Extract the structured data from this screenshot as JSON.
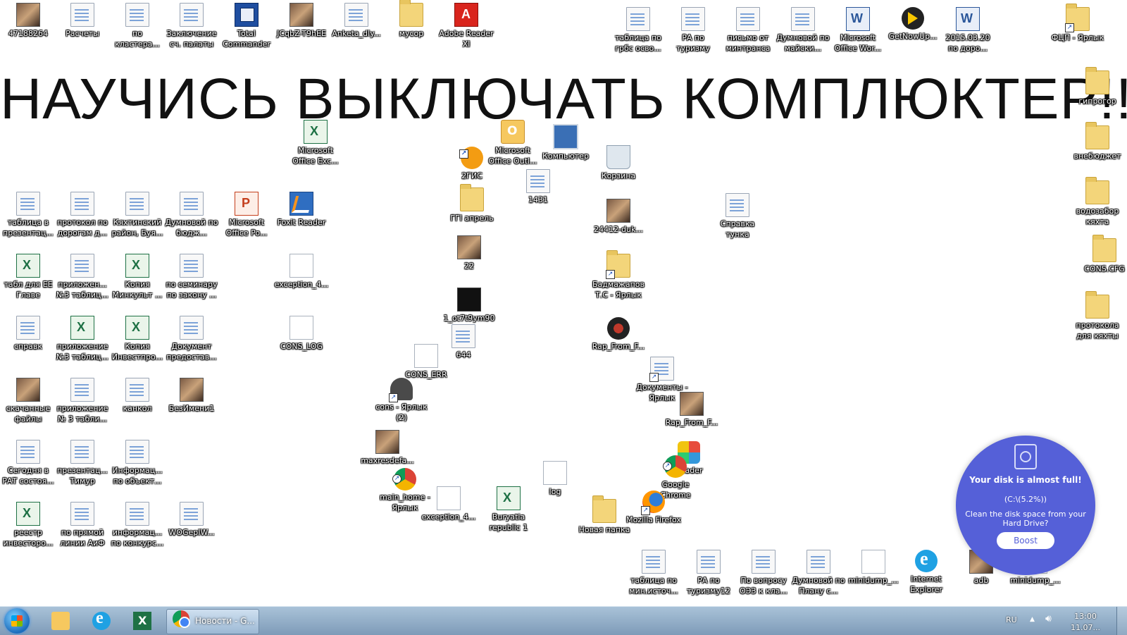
{
  "banner": "НАУЧИСЬ ВЫКЛЮЧАТЬ КОМПЛЮКТЕР!!!!",
  "icons": [
    {
      "label": "47188264",
      "type": "photo"
    },
    {
      "label": "Расчеты",
      "type": "doc"
    },
    {
      "label": "по кластера...",
      "type": "doc"
    },
    {
      "label": "Заключение сч. палаты",
      "type": "doc"
    },
    {
      "label": "Total Commander",
      "type": "tc"
    },
    {
      "label": "JCqbZ-T9hEE",
      "type": "photo"
    },
    {
      "label": "Anketa_dly...",
      "type": "doc"
    },
    {
      "label": "мусор",
      "type": "folder"
    },
    {
      "label": "Adobe Reader XI",
      "type": "pdf"
    },
    {
      "label": "таблица по грбс осво...",
      "type": "doc"
    },
    {
      "label": "РА по туризму",
      "type": "doc"
    },
    {
      "label": "письмо от минтранса",
      "type": "doc"
    },
    {
      "label": "Думновой по майски...",
      "type": "doc"
    },
    {
      "label": "Microsoft Office Wor...",
      "type": "word"
    },
    {
      "label": "GetNowUp...",
      "type": "getnow"
    },
    {
      "label": "2015.03.20 по доро...",
      "type": "word"
    },
    {
      "label": "ФЦП - Ярлык",
      "type": "folder"
    },
    {
      "label": "гипрогор",
      "type": "folder"
    },
    {
      "label": "внебюджет",
      "type": "folder"
    },
    {
      "label": "водозабор кяхта",
      "type": "folder"
    },
    {
      "label": "CONS.CFG",
      "type": "folder"
    },
    {
      "label": "протокола для кяхты",
      "type": "folder"
    },
    {
      "label": "Microsoft Office Exc...",
      "type": "xls"
    },
    {
      "label": "Microsoft Office Outl...",
      "type": "outlook"
    },
    {
      "label": "Компьютер",
      "type": "pc"
    },
    {
      "label": "2ГИС",
      "type": "gis"
    },
    {
      "label": "Корзина",
      "type": "bin"
    },
    {
      "label": "1431",
      "type": "doc"
    },
    {
      "label": "ГГI апрель",
      "type": "folder"
    },
    {
      "label": "22",
      "type": "photo"
    },
    {
      "label": "1_ot7t9ym90",
      "type": "dark"
    },
    {
      "label": "644",
      "type": "doc"
    },
    {
      "label": "CONS_ERR",
      "type": "blank"
    },
    {
      "label": "cons - Ярлык (2)",
      "type": "cons"
    },
    {
      "label": "maxresdefa...",
      "type": "photo"
    },
    {
      "label": "main_home - Ярлык",
      "type": "chrome"
    },
    {
      "label": "exception_4...",
      "type": "blank"
    },
    {
      "label": "Buryatia republic 1",
      "type": "xls"
    },
    {
      "label": "log",
      "type": "blank"
    },
    {
      "label": "24412-duk...",
      "type": "photo"
    },
    {
      "label": "Бадмажапов Т.С - Ярлык",
      "type": "folder"
    },
    {
      "label": "Rap_From_F...",
      "type": "rap"
    },
    {
      "label": "Документы - Ярлык",
      "type": "doc"
    },
    {
      "label": "Rap_From_F...",
      "type": "photo"
    },
    {
      "label": "Reader",
      "type": "reader"
    },
    {
      "label": "Google Chrome",
      "type": "chrome"
    },
    {
      "label": "Новая папка",
      "type": "folder"
    },
    {
      "label": "Mozilla Firefox",
      "type": "firefox"
    },
    {
      "label": "Справка тунка",
      "type": "doc"
    },
    {
      "label": "таблица в презентац...",
      "type": "doc"
    },
    {
      "label": "протокол по дорогам д...",
      "type": "doc"
    },
    {
      "label": "Кяхтинский район, Буя...",
      "type": "doc"
    },
    {
      "label": "Думновой по бюдж...",
      "type": "doc"
    },
    {
      "label": "Microsoft Office Po...",
      "type": "ppt"
    },
    {
      "label": "Foxit Reader",
      "type": "foxit"
    },
    {
      "label": "табл для ЕЕ Главе",
      "type": "xls"
    },
    {
      "label": "приложен... №3 таблиц...",
      "type": "doc"
    },
    {
      "label": "Копия Минкульт ...",
      "type": "xls"
    },
    {
      "label": "по семинару по закону ...",
      "type": "doc"
    },
    {
      "label": "exception_4...",
      "type": "blank"
    },
    {
      "label": "справк",
      "type": "doc"
    },
    {
      "label": "приложение №3 таблиц...",
      "type": "xls"
    },
    {
      "label": "Копия Инвестпро...",
      "type": "xls"
    },
    {
      "label": "Документ предостав...",
      "type": "doc"
    },
    {
      "label": "CONS_LOG",
      "type": "blank"
    },
    {
      "label": "скачанные файлы",
      "type": "photo"
    },
    {
      "label": "приложение № 3 табли...",
      "type": "doc"
    },
    {
      "label": "канкол",
      "type": "doc"
    },
    {
      "label": "БезИмени1",
      "type": "photo"
    },
    {
      "label": "Сегодня в РАТ состоя...",
      "type": "doc"
    },
    {
      "label": "презентац... Тимур",
      "type": "doc"
    },
    {
      "label": "Информац... по объект...",
      "type": "doc"
    },
    {
      "label": "реестр инвесторо...",
      "type": "xls"
    },
    {
      "label": "по прямой линии АиФ",
      "type": "doc"
    },
    {
      "label": "информац... по конкурс...",
      "type": "doc"
    },
    {
      "label": "WOGepIW...",
      "type": "doc"
    },
    {
      "label": "таблица по мин.источ...",
      "type": "doc"
    },
    {
      "label": "РА по туризму12",
      "type": "doc"
    },
    {
      "label": "По вопросу ОЭЗ к кла...",
      "type": "doc"
    },
    {
      "label": "Думновой по Плану с...",
      "type": "doc"
    },
    {
      "label": "minidump_...",
      "type": "blank"
    },
    {
      "label": "Internet Explorer",
      "type": "ie"
    },
    {
      "label": "adb",
      "type": "photo"
    },
    {
      "label": "minidump_...",
      "type": "blank"
    }
  ],
  "popup": {
    "title": "Your disk is almost full!",
    "drive": "(C:\\(5.2%))",
    "message": "Clean the disk space from your Hard Drive?",
    "button": "Boost"
  },
  "taskbar": {
    "active_window": "Новости - G...",
    "language": "RU",
    "time": "13:00",
    "date": "11.07..."
  },
  "colors": {
    "popup_bg": "#5560d8",
    "taskbar_top": "#a9c2d8",
    "taskbar_bottom": "#7e9bb8"
  }
}
